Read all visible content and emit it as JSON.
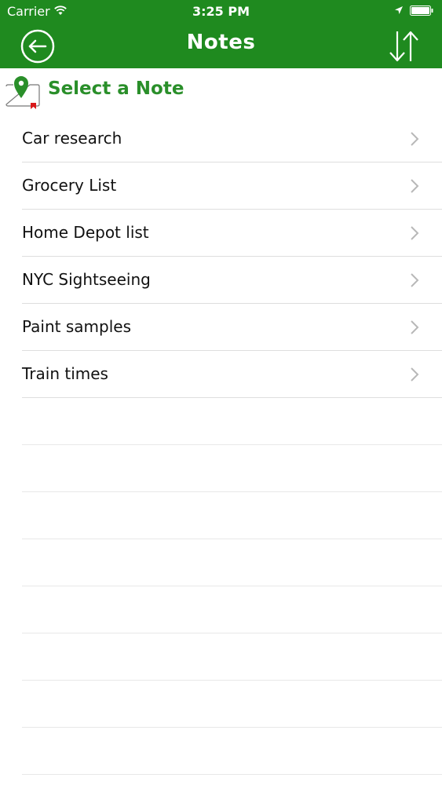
{
  "status_bar": {
    "carrier": "Carrier",
    "time": "3:25 PM",
    "icons": [
      "wifi-icon",
      "location-arrow-icon",
      "battery-icon"
    ]
  },
  "nav": {
    "title": "Notes",
    "back_icon": "back-arrow-circle-icon",
    "sort_icon": "sort-arrows-icon"
  },
  "section": {
    "title": "Select a Note",
    "icon": "map-pin-bookmark-icon"
  },
  "notes": [
    {
      "label": "Car research"
    },
    {
      "label": "Grocery List"
    },
    {
      "label": "Home Depot list"
    },
    {
      "label": "NYC Sightseeing"
    },
    {
      "label": "Paint samples"
    },
    {
      "label": "Train times"
    }
  ],
  "colors": {
    "header_green": "#1f8a1f",
    "accent_green": "#2a8f2a",
    "bookmark_red": "#d9191b"
  }
}
